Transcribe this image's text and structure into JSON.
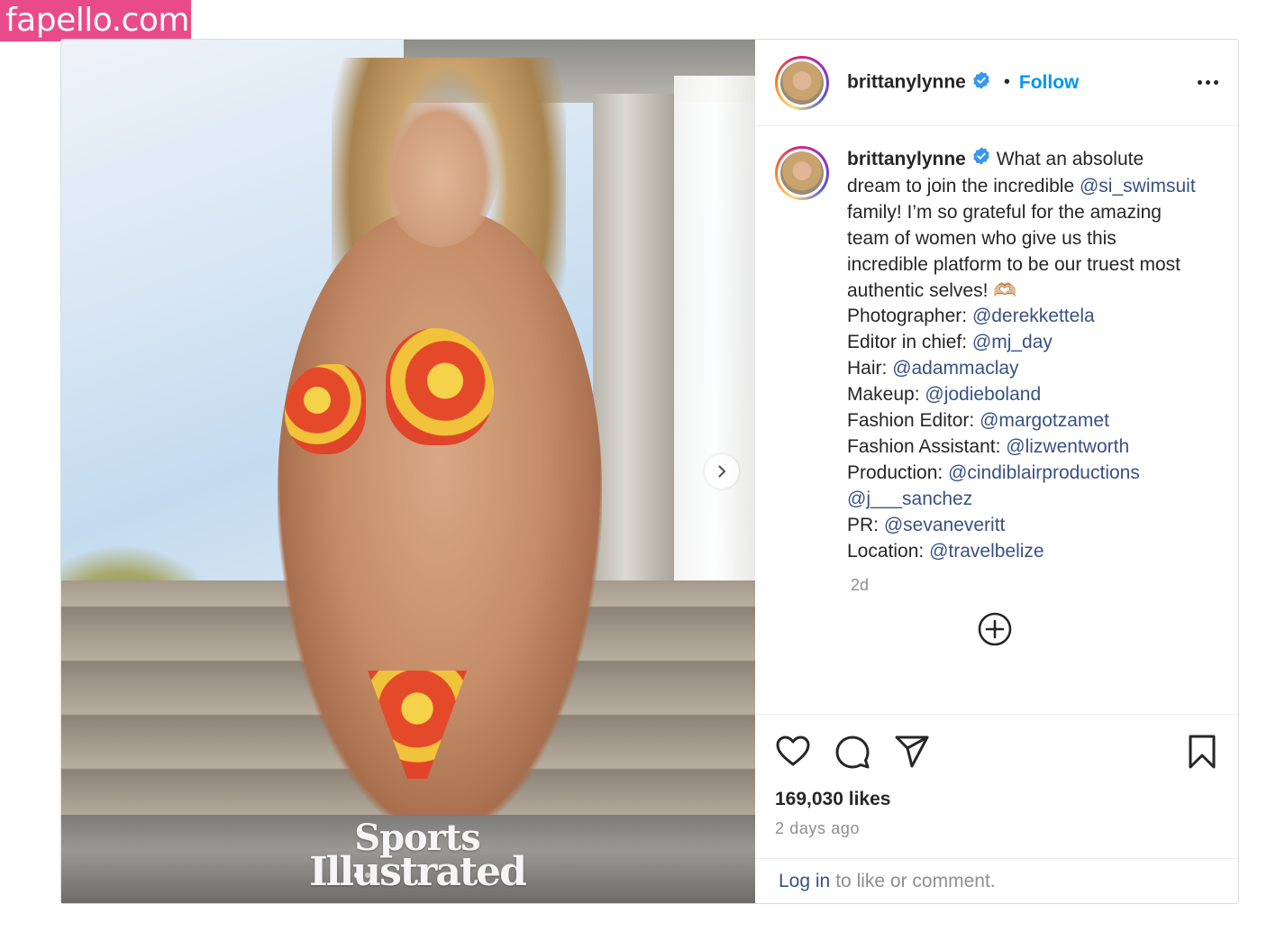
{
  "watermark": "fapello.com",
  "header": {
    "username": "brittanylynne",
    "bullet": "•",
    "follow_label": "Follow",
    "more_label": "More options"
  },
  "media": {
    "brand_line1": "Sports",
    "brand_line2": "Illustrated",
    "carousel_dots": 2,
    "active_dot": 0
  },
  "caption": {
    "username": "brittanylynne",
    "segments": [
      {
        "text": " What an absolute dream to join the incredible ",
        "type": "text"
      },
      {
        "text": "@si_swimsuit",
        "type": "mention"
      },
      {
        "text": " family! I’m so grateful for the amazing team of women who give us this incredible platform to be our truest most authentic selves! 🫶🏼",
        "type": "text"
      }
    ],
    "credits": [
      {
        "label": "Photographer: ",
        "handle": "@derekkettela"
      },
      {
        "label": "Editor in chief: ",
        "handle": "@mj_day"
      },
      {
        "label": "Hair: ",
        "handle": "@adammaclay"
      },
      {
        "label": "Makeup: ",
        "handle": "@jodieboland"
      },
      {
        "label": "Fashion Editor: ",
        "handle": "@margotzamet"
      },
      {
        "label": "Fashion Assistant: ",
        "handle": "@lizwentworth"
      },
      {
        "label": "Production: ",
        "handle": "@cindiblairproductions"
      },
      {
        "label": "",
        "handle": "@j___sanchez"
      },
      {
        "label": "PR: ",
        "handle": "@sevaneveritt"
      },
      {
        "label": "Location: ",
        "handle": "@travelbelize"
      }
    ],
    "age": "2d"
  },
  "actions": {
    "likes": "169,030 likes",
    "timestamp": "2 days ago"
  },
  "login": {
    "link": "Log in",
    "rest": "to like or comment."
  },
  "colors": {
    "link_blue": "#0095f6",
    "mention_blue": "#385185",
    "muted": "#8e8e8e",
    "watermark_pink": "#e94b8a"
  }
}
